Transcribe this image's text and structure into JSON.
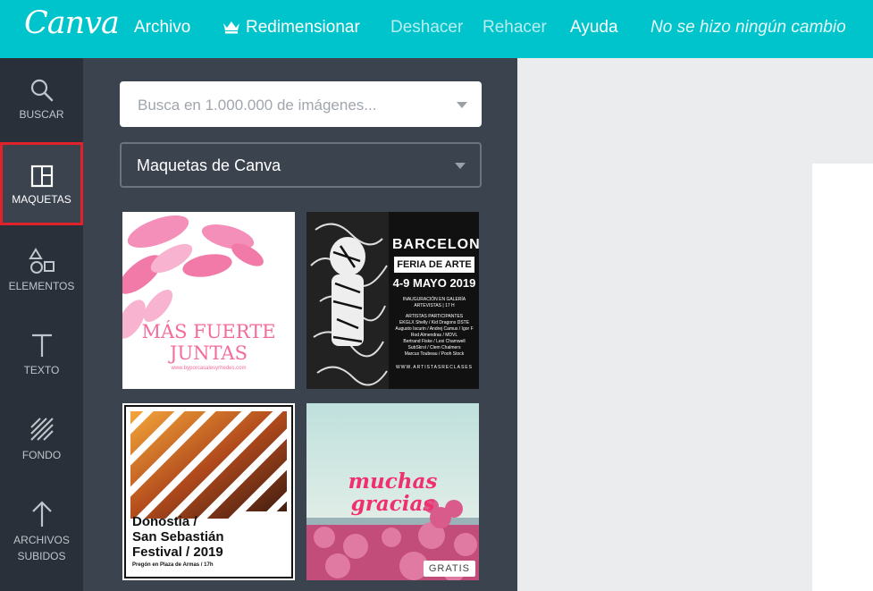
{
  "header": {
    "logo": "Canva",
    "menu": [
      {
        "label": "Archivo"
      },
      {
        "label": "Redimensionar"
      },
      {
        "label": "Deshacer"
      },
      {
        "label": "Rehacer"
      },
      {
        "label": "Ayuda"
      }
    ],
    "status": "No se hizo ningún cambio"
  },
  "sidebar": {
    "items": [
      {
        "label": "BUSCAR",
        "icon": "search-icon"
      },
      {
        "label": "MAQUETAS",
        "icon": "layout-icon",
        "active": true
      },
      {
        "label": "ELEMENTOS",
        "icon": "shapes-icon"
      },
      {
        "label": "TEXTO",
        "icon": "text-icon"
      },
      {
        "label": "FONDO",
        "icon": "background-icon"
      },
      {
        "label": "ARCHIVOS SUBIDOS",
        "icon": "upload-icon"
      }
    ]
  },
  "panel": {
    "search_placeholder": "Busca en 1.000.000 de imágenes...",
    "category": "Maquetas de Canva",
    "templates": [
      {
        "title": "MÁS FUERTE JUNTAS",
        "subtitle": "www.byporcasalesyrhedes.com"
      },
      {
        "title": "BARCELONA",
        "subtitle": "FERIA DE ARTE",
        "date": "4-9 MAYO 2019",
        "info": "INAUGURACIÓN EN GALERÍA ARTEVISTAS | 17 H",
        "artists_title": "ARTISTAS PARTICIPANTES",
        "artists": [
          "EKGLX Shelly / Kid Dragons DSTE",
          "Augusto Iscurin / Andrej Camus / Igor F",
          "Rod Almendras / MDVL",
          "Bertrand Fiske / Lexi Chamwell",
          "SubSkrol / Clem Chalmers",
          "Marcus Toubeau / Pooh Stock"
        ],
        "footer": "WWW.ARTISTASRECLASES"
      },
      {
        "title_line1": "Donostia /",
        "title_line2": "San Sebastián",
        "title_line3": "Festival / 2019",
        "footer": "Pregón en Plaza de Armas / 17h"
      },
      {
        "title_line1": "muchas",
        "title_line2": "gracias",
        "badge": "GRATIS"
      }
    ]
  },
  "colors": {
    "brand": "#00c4cc",
    "sidebar": "#293039",
    "panel": "#3b434f",
    "active_outline": "#e0222a",
    "pink": "#f56a9c"
  }
}
